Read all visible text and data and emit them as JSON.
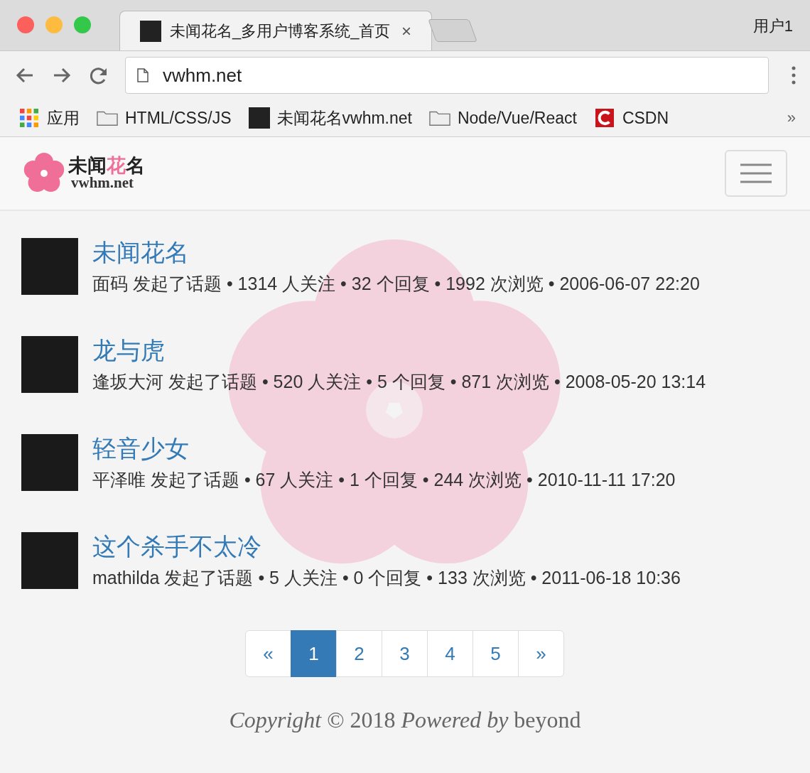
{
  "browser": {
    "tabs": [
      {
        "kind": "page",
        "title": "未闻花名_多用户博客系统_首页",
        "close": "×",
        "selected": true
      },
      {
        "kind": "new",
        "selected": false
      }
    ],
    "profile": "用户1",
    "url": "vwhm.net",
    "bookmarks": [
      {
        "kind": "apps",
        "label": "应用"
      },
      {
        "kind": "folder",
        "label": "HTML/CSS/JS"
      },
      {
        "kind": "site",
        "label": "未闻花名vwhm.net"
      },
      {
        "kind": "folder",
        "label": "Node/Vue/React"
      },
      {
        "kind": "csdn",
        "label": "CSDN"
      }
    ],
    "bookmarks_overflow": "»"
  },
  "navbar": {
    "logo": {
      "title_start": "未闻",
      "title_highlight": "花",
      "title_end": "名",
      "subtitle": "vwhm.net"
    }
  },
  "topics": [
    {
      "title": "未闻花名",
      "meta": "面码 发起了话题 • 1314 人关注 • 32 个回复 • 1992 次浏览 • 2006-06-07 22:20"
    },
    {
      "title": "龙与虎",
      "meta": "逢坂大河 发起了话题 • 520 人关注 • 5 个回复 • 871 次浏览 • 2008-05-20 13:14"
    },
    {
      "title": "轻音少女",
      "meta": "平泽唯 发起了话题 • 67 人关注 • 1 个回复 • 244 次浏览 • 2010-11-11 17:20"
    },
    {
      "title": "这个杀手不太冷",
      "meta": "mathilda 发起了话题 • 5 人关注 • 0 个回复 • 133 次浏览 • 2011-06-18 10:36"
    }
  ],
  "pagination": {
    "prev": "«",
    "pages": [
      {
        "label": "1",
        "selected": true
      },
      {
        "label": "2",
        "selected": false
      },
      {
        "label": "3",
        "selected": false
      },
      {
        "label": "4",
        "selected": false
      },
      {
        "label": "5",
        "selected": false
      }
    ],
    "next": "»"
  },
  "footer": "*Copyright* © 2018 *Powered by* beyond"
}
